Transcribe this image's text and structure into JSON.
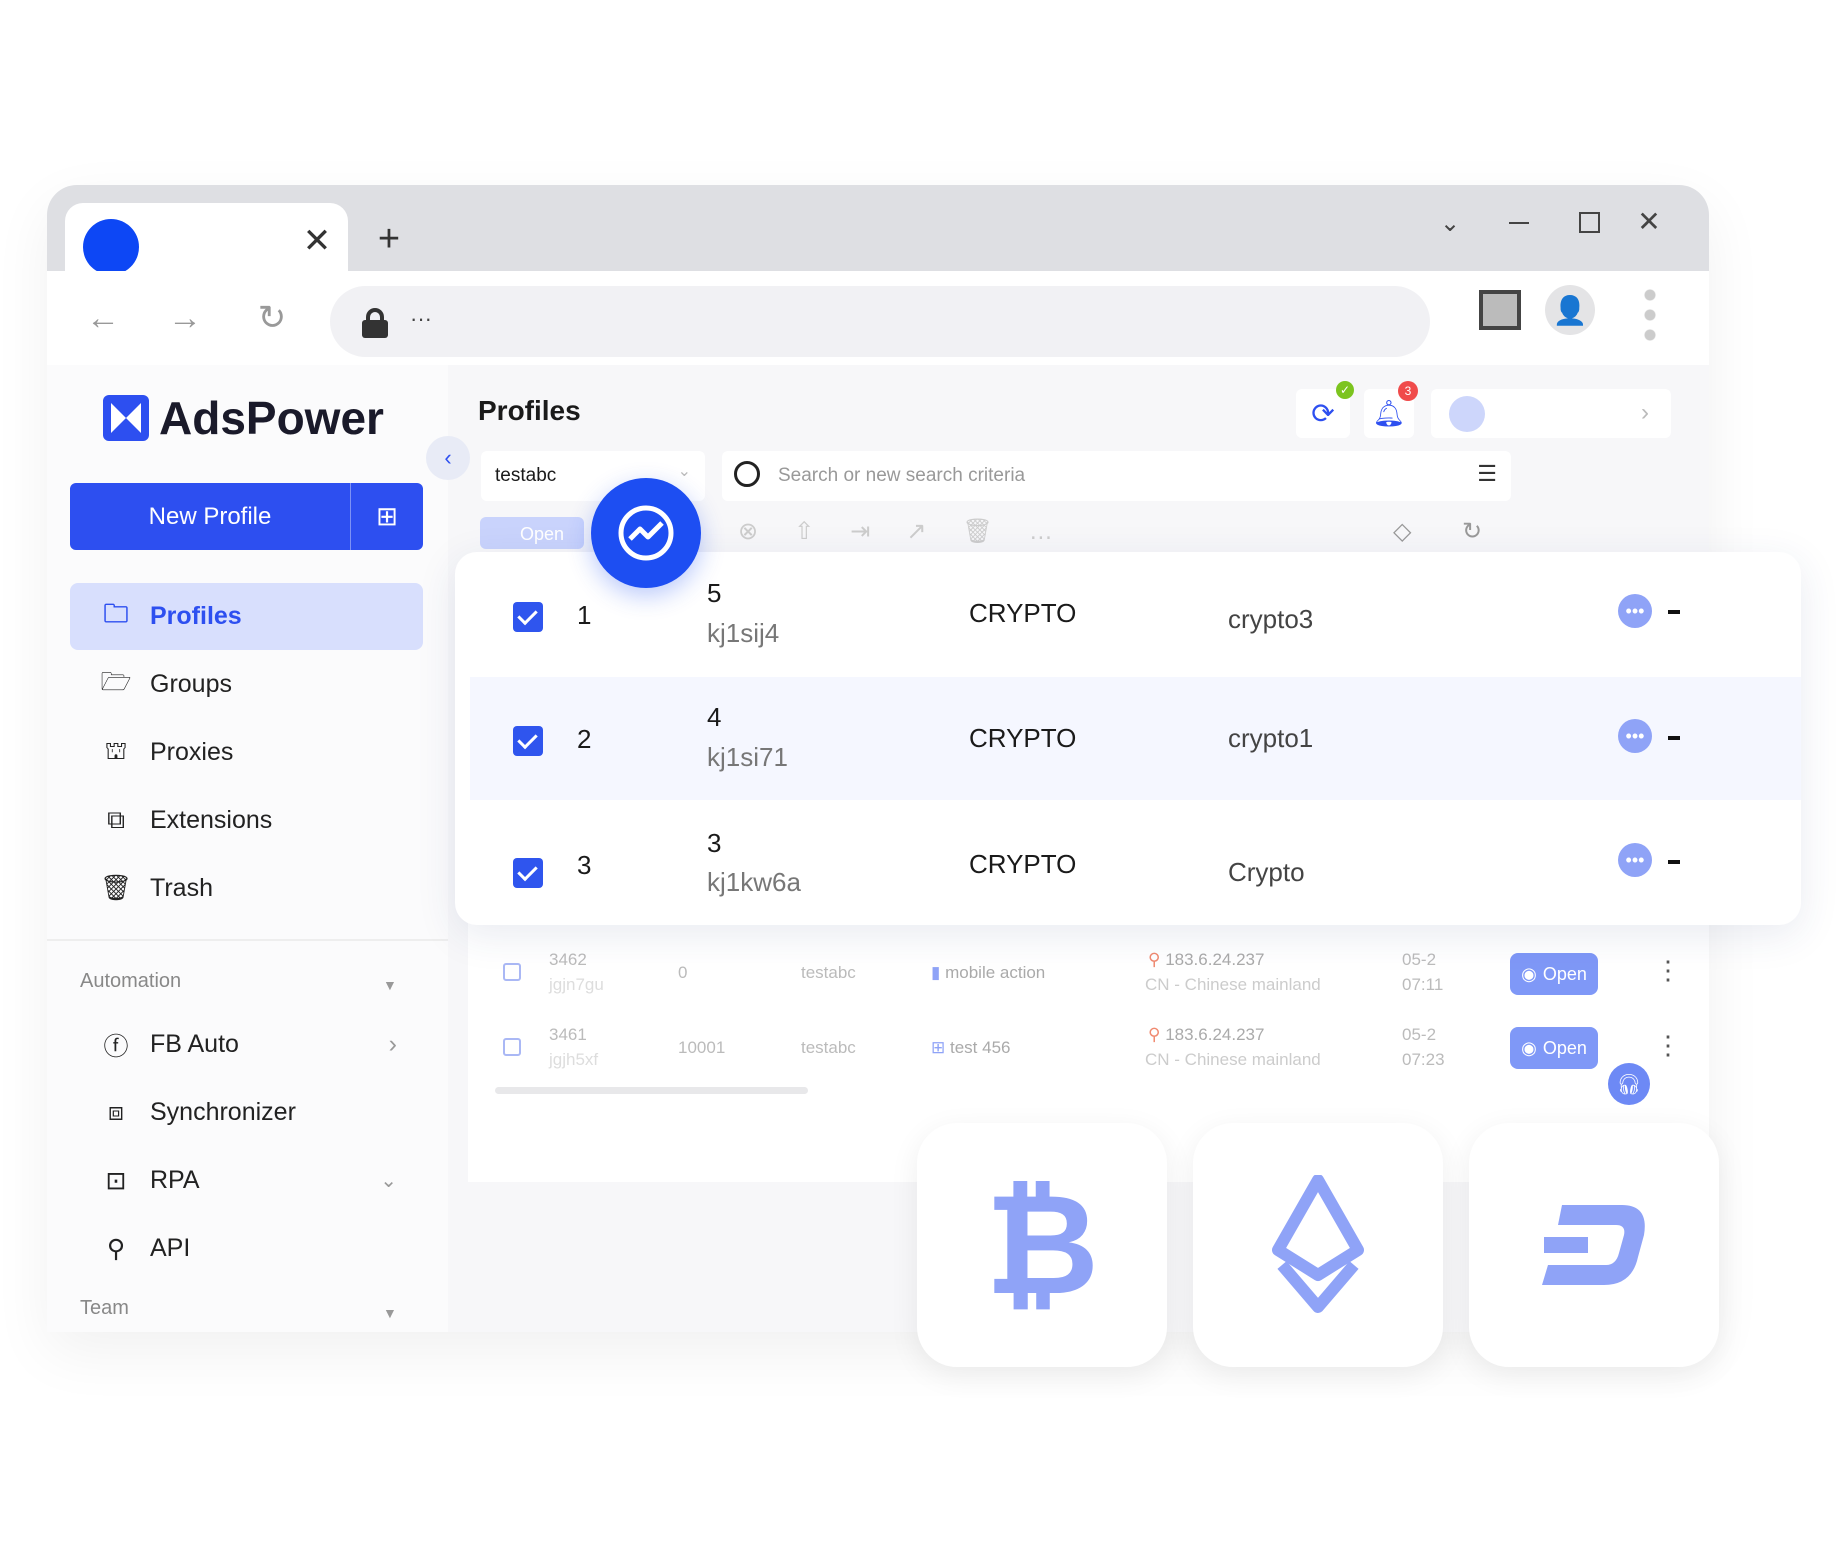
{
  "browser": {
    "url_text": "···"
  },
  "sidebar": {
    "logo": "AdsPower",
    "new_profile": "New Profile",
    "items": [
      {
        "label": "Profiles",
        "icon": "folder-icon"
      },
      {
        "label": "Groups",
        "icon": "open-folder-icon"
      },
      {
        "label": "Proxies",
        "icon": "network-icon"
      },
      {
        "label": "Extensions",
        "icon": "puzzle-icon"
      },
      {
        "label": "Trash",
        "icon": "trash-icon"
      }
    ],
    "automation_label": "Automation",
    "automation": [
      {
        "label": "FB Auto",
        "icon": "facebook-icon"
      },
      {
        "label": "Synchronizer",
        "icon": "sync-windows-icon"
      },
      {
        "label": "RPA",
        "icon": "robot-icon"
      },
      {
        "label": "API",
        "icon": "plug-icon"
      }
    ],
    "team_label": "Team"
  },
  "header": {
    "title": "Profiles",
    "notification_count": "3",
    "group_select": "testabc",
    "search_placeholder": "Search or new search criteria",
    "open_label": "Open"
  },
  "selected_rows": [
    {
      "index": "1",
      "number": "5",
      "id": "kj1sij4",
      "group": "CRYPTO",
      "name": "crypto3"
    },
    {
      "index": "2",
      "number": "4",
      "id": "kj1si71",
      "group": "CRYPTO",
      "name": "crypto1"
    },
    {
      "index": "3",
      "number": "3",
      "id": "kj1kw6a",
      "group": "CRYPTO",
      "name": "Crypto"
    }
  ],
  "bg_rows": [
    {
      "number": "3462",
      "id": "jgjn7gu",
      "col": "0",
      "group": "testabc",
      "tag": "mobile action",
      "ip": "183.6.24.237",
      "region": "CN - Chinese mainland",
      "date": "05-2",
      "time": "07:11",
      "open": "Open"
    },
    {
      "number": "3461",
      "id": "jgjh5xf",
      "col": "10001",
      "group": "testabc",
      "tag": "test 456",
      "ip": "183.6.24.237",
      "region": "CN - Chinese mainland",
      "date": "05-2",
      "time": "07:23",
      "open": "Open"
    }
  ],
  "colors": {
    "accent": "#2d4ff0",
    "active_bg": "#d8dffd",
    "crypto_icon": "#8fa3f7"
  },
  "crypto_cards": [
    "bitcoin-icon",
    "ethereum-icon",
    "dash-icon"
  ]
}
